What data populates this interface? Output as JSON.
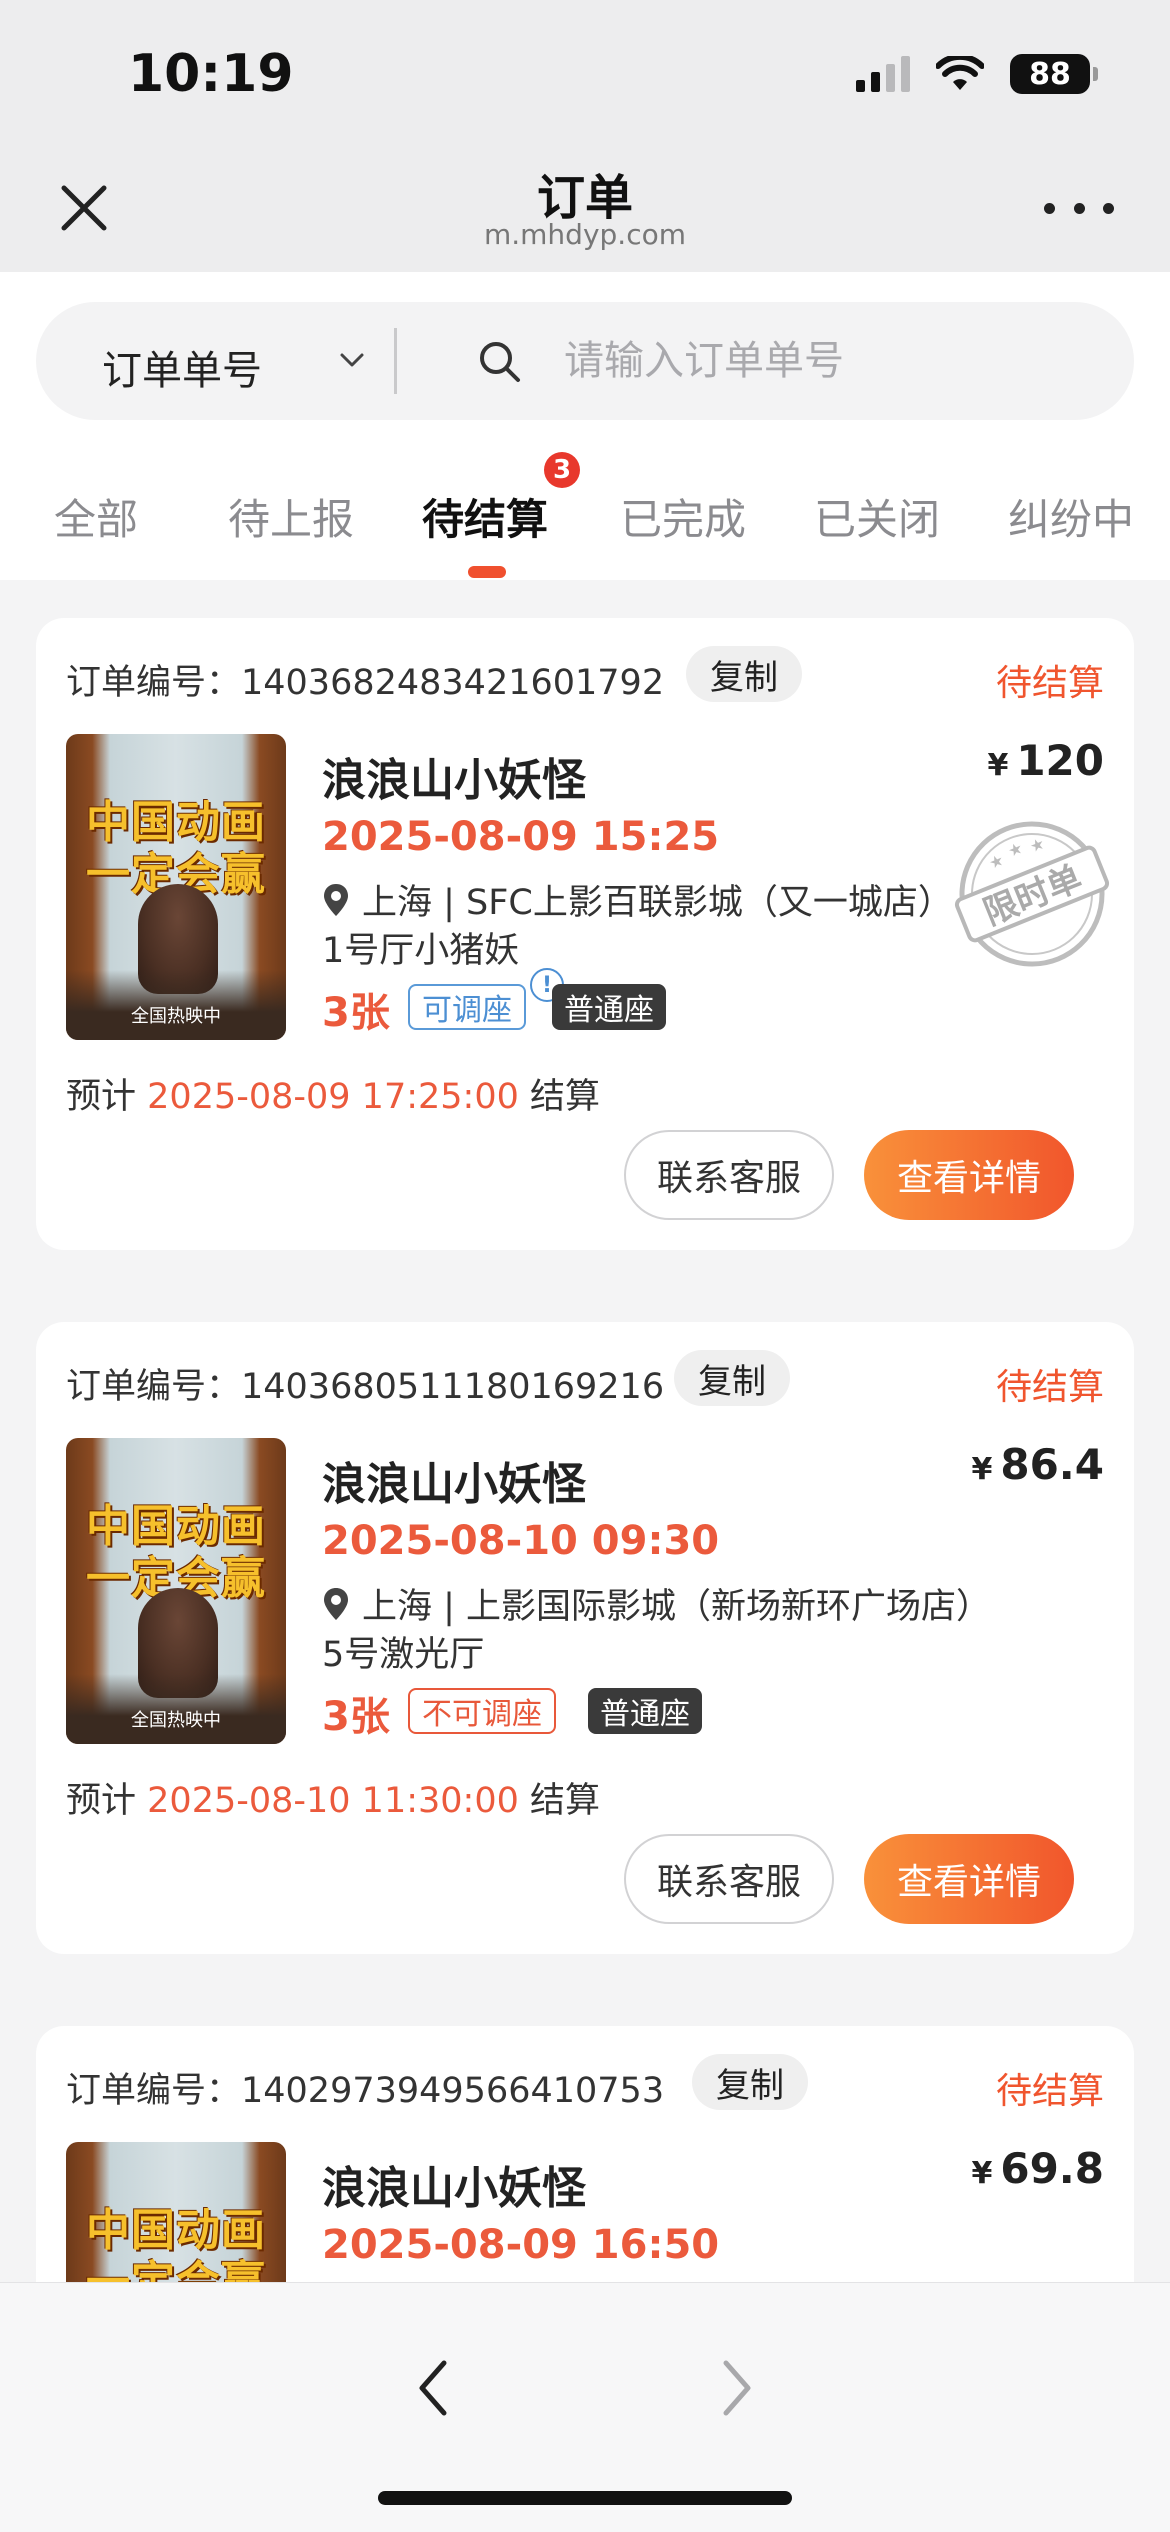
{
  "status_bar": {
    "time": "10:19",
    "battery": "88"
  },
  "header": {
    "title": "订单",
    "url": "m.mhdyp.com"
  },
  "search": {
    "type_label": "订单单号",
    "placeholder": "请输入订单单号"
  },
  "tabs": [
    {
      "label": "全部"
    },
    {
      "label": "待上报"
    },
    {
      "label": "待结算",
      "active": true,
      "badge": "3"
    },
    {
      "label": "已完成"
    },
    {
      "label": "已关闭"
    },
    {
      "label": "纠纷中"
    }
  ],
  "colors": {
    "accent": "#f0552e",
    "price_red": "#eb5a3c",
    "adjust_blue": "#4c8fd3"
  },
  "poster": {
    "line1": "中国动画",
    "line2": "一定会赢",
    "caption": "全国热映中"
  },
  "orders": [
    {
      "order_no": "订单编号：1403682483421601792",
      "copy": "复制",
      "status": "待结算",
      "title": "浪浪山小妖怪",
      "price_symbol": "¥",
      "price": "120",
      "show_time": "2025-08-09 15:25",
      "cinema": "上海 | SFC上影百联影城（又一城店）",
      "hall": "1号厅小猪妖",
      "tickets": "3张",
      "seat_adjust": "可调座",
      "seat_type": "普通座",
      "stamp": "限时单",
      "settle_prefix": "预计",
      "settle_time": "2025-08-09 17:25:00",
      "settle_suffix": "结算",
      "service_btn": "联系客服",
      "detail_btn": "查看详情"
    },
    {
      "order_no": "订单编号：1403680511180169216",
      "copy": "复制",
      "status": "待结算",
      "title": "浪浪山小妖怪",
      "price_symbol": "¥",
      "price": "86.4",
      "show_time": "2025-08-10 09:30",
      "cinema": "上海 | 上影国际影城（新场新环广场店）",
      "hall": "5号激光厅",
      "tickets": "3张",
      "seat_adjust": "不可调座",
      "seat_type": "普通座",
      "settle_prefix": "预计",
      "settle_time": "2025-08-10 11:30:00",
      "settle_suffix": "结算",
      "service_btn": "联系客服",
      "detail_btn": "查看详情"
    },
    {
      "order_no": "订单编号：1402973949566410753",
      "copy": "复制",
      "status": "待结算",
      "title": "浪浪山小妖怪",
      "price_symbol": "¥",
      "price": "69.8",
      "show_time": "2025-08-09 16:50"
    }
  ]
}
